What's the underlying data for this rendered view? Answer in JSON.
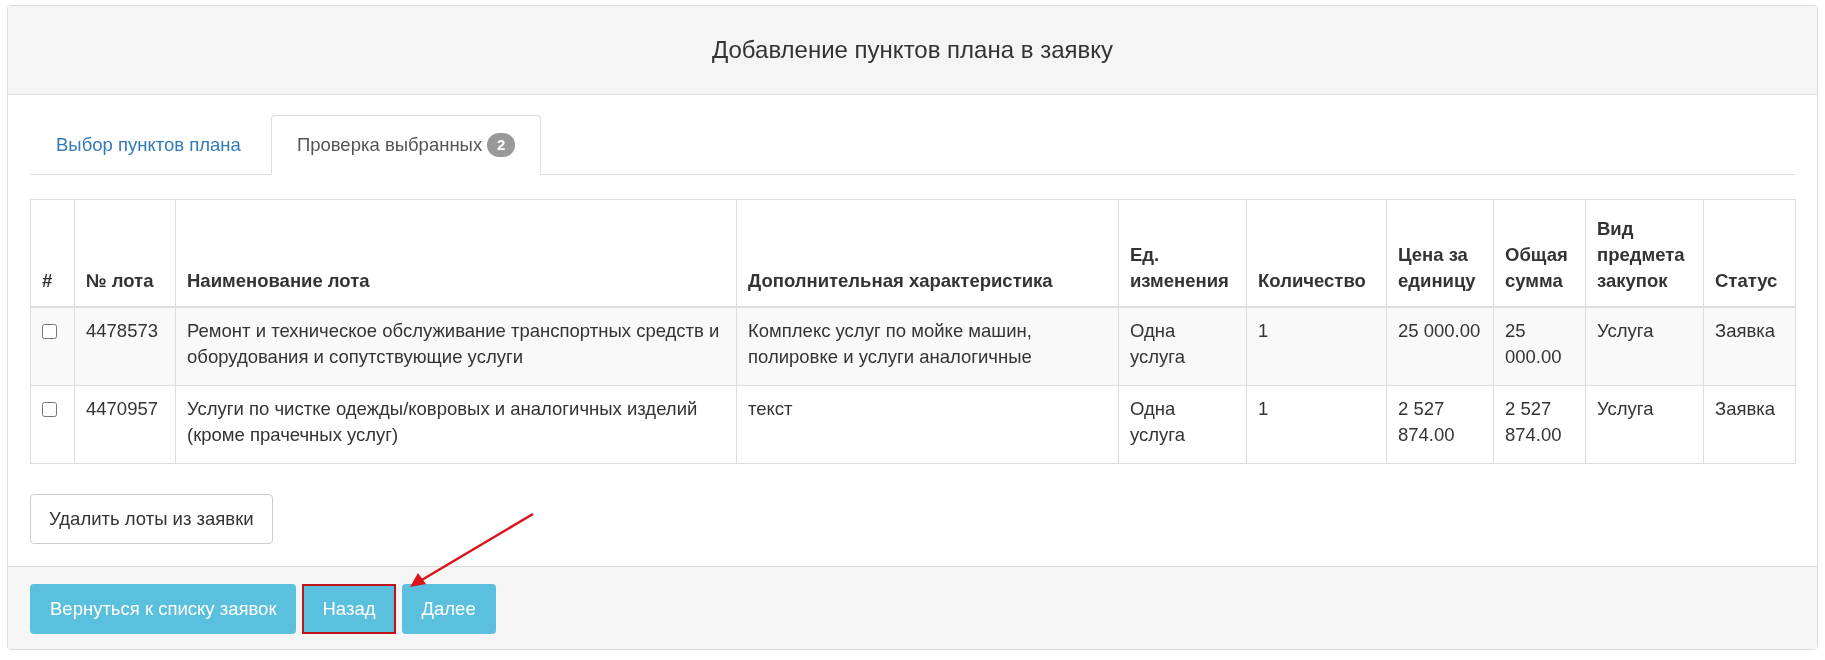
{
  "dialog": {
    "title": "Добавление пунктов плана в заявку"
  },
  "tabs": [
    {
      "label": "Выбор пунктов плана",
      "selected": false
    },
    {
      "label": "Проверка выбранных",
      "badge": "2",
      "selected": true
    }
  ],
  "table": {
    "columns": [
      "#",
      "№ лота",
      "Наименование лота",
      "Дополнительная характеристика",
      "Ед. изменения",
      "Количество",
      "Цена за единицу",
      "Общая сумма",
      "Вид предмета закупок",
      "Статус"
    ],
    "rows": [
      {
        "checked": false,
        "cells": [
          "",
          "4478573",
          "Ремонт и техническое обслуживание транспортных средств и оборудования и сопутствующие услуги",
          "Комплекс услуг по мойке машин, полировке и услуги аналогичные",
          "Одна услуга",
          "1",
          "25 000.00",
          "25 000.00",
          "Услуга",
          "Заявка"
        ]
      },
      {
        "checked": false,
        "cells": [
          "",
          "4470957",
          "Услуги по чистке одежды/ковровых и аналогичных изделий (кроме прачечных услуг)",
          "текст",
          "Одна услуга",
          "1",
          "2 527 874.00",
          "2 527 874.00",
          "Услуга",
          "Заявка"
        ]
      }
    ]
  },
  "delete_button": "Удалить лоты из заявки",
  "footer_buttons": [
    {
      "label": "Вернуться к списку заявок",
      "highlighted": false
    },
    {
      "label": "Назад",
      "highlighted": true
    },
    {
      "label": "Далее",
      "highlighted": false
    }
  ]
}
